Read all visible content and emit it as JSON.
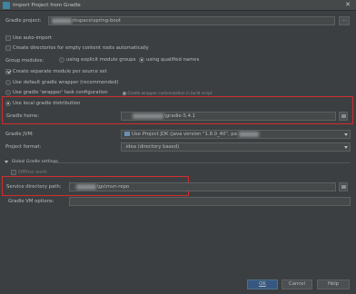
{
  "window": {
    "title": "Import Project from Gradle",
    "close_glyph": "✕"
  },
  "gradle_project": {
    "label": "Gradle project:",
    "value": "rkspace\\spring-boot",
    "browse_label": "..."
  },
  "options": {
    "auto_import": "Use auto-import",
    "create_dirs": "Create directories for empty content roots automatically",
    "group_modules_label": "Group modules:",
    "explicit_groups": "using explicit module groups",
    "qualified_names": "using qualified names",
    "separate_module": "Create separate module per source set",
    "default_wrapper": "Use default gradle wrapper (recommended)",
    "wrapper_task": "Use gradle 'wrapper' task configuration",
    "wrapper_hint": "Gradle wrapper customization in build script",
    "local_dist": "Use local gradle distribution"
  },
  "gradle_home": {
    "label": "Gradle home:",
    "value": "\\gradle-5.4.1"
  },
  "gradle_jvm": {
    "label": "Gradle JVM:",
    "value": "Use Project JDK (java version \"1.8.0_40\", pa"
  },
  "project_format": {
    "label": "Project format:",
    "value": ".idea (directory based)"
  },
  "global": {
    "section_label": "Global Gradle settings",
    "offline_work": "Offline work",
    "service_dir_label": "Service directory path:",
    "service_dir_value": "\\gs\\mvn-repo",
    "vm_options_label": "Gradle VM options:",
    "vm_options_value": ""
  },
  "buttons": {
    "ok": "OK",
    "cancel": "Cancel",
    "help": "Help"
  },
  "colors": {
    "background": "#3c3f41",
    "highlight_border": "#d12d2d",
    "primary_button": "#365880"
  },
  "icons": [
    "app-icon",
    "close-icon",
    "folder-icon",
    "jdk-icon",
    "chevron-down-icon",
    "expand-triangle-icon"
  ]
}
